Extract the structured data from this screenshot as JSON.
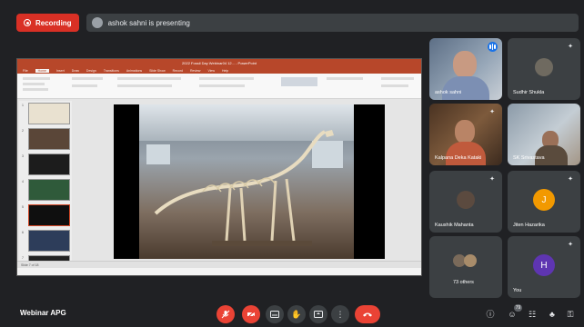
{
  "top_bar": {
    "recording_label": "Recording",
    "presenting_text": "ashok sahni is presenting"
  },
  "shared_screen": {
    "window_title": "2022 Fossil Day Webinar04 12... - PowerPoint",
    "ribbon_tabs": [
      "File",
      "Home",
      "Insert",
      "Draw",
      "Design",
      "Transitions",
      "Animations",
      "Slide Show",
      "Record",
      "Review",
      "View",
      "Help"
    ],
    "active_tab": "Home",
    "slide_numbers": [
      "1",
      "2",
      "3",
      "4",
      "5",
      "6",
      "7"
    ],
    "notes_placeholder": "Click to add notes",
    "status_text": "Slide 7 of 18"
  },
  "participants": [
    {
      "name": "ashok sahni",
      "type": "video",
      "speaking": true
    },
    {
      "name": "Sudhir Shukla",
      "type": "avatar",
      "muted": true
    },
    {
      "name": "Kalpana Deka Kataki",
      "type": "video",
      "muted": true
    },
    {
      "name": "SK Srivastava",
      "type": "video",
      "muted": false
    },
    {
      "name": "Kaushik Mahanta",
      "type": "avatar",
      "muted": true
    },
    {
      "name": "Jiten Hazarika",
      "type": "letter",
      "letter": "J",
      "color": "#f29900",
      "muted": true
    },
    {
      "name": "73 others",
      "type": "group"
    },
    {
      "name": "You",
      "type": "letter",
      "letter": "H",
      "color": "#5e35b1",
      "muted": true
    }
  ],
  "bottom_bar": {
    "meeting_name": "Webinar APG",
    "controls": [
      "mic-off",
      "camera-off",
      "captions",
      "raise-hand",
      "present",
      "more-options",
      "leave-call"
    ],
    "people_count": "79"
  },
  "colors": {
    "background": "#202124",
    "tile": "#3c4043",
    "danger": "#ea4335",
    "accent": "#1a73e8"
  }
}
